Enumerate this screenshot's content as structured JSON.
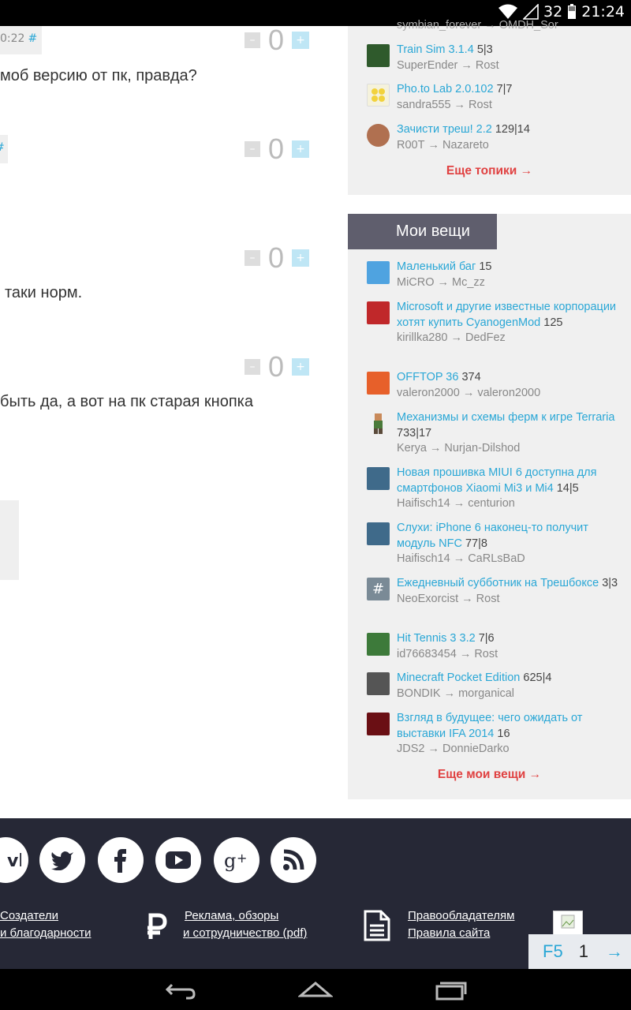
{
  "status_bar": {
    "battery": "32",
    "time": "21:24"
  },
  "comments": [
    {
      "time": "0:22",
      "hash": "#",
      "score": "0",
      "text": "моб версию от пк, правда?"
    },
    {
      "time": "",
      "hash": "#",
      "score": "0",
      "text": ""
    },
    {
      "time": "",
      "hash": "",
      "score": "0",
      "text": "таки норм."
    },
    {
      "time": "",
      "hash": "",
      "score": "0",
      "text": "быть да, а вот на пк старая кнопка"
    }
  ],
  "vote": {
    "minus": "–",
    "plus": "+"
  },
  "topics": {
    "cut_off": "symbian_forever → OMDH_Sor",
    "items": [
      {
        "title": "Train Sim 3.1.4",
        "count": "5|3",
        "author": "SuperEnder",
        "last": "Rost",
        "avatar_color": "#2f5a2c"
      },
      {
        "title": "Pho.to Lab 2.0.102",
        "count": "7|7",
        "author": "sandra555",
        "last": "Rost",
        "avatar_color": "#f3e9a0"
      },
      {
        "title": "Зачисти треш! 2.2",
        "count": "129|14",
        "author": "R00T",
        "last": "Nazareto",
        "avatar_color": "#b07050"
      }
    ],
    "more": "Еще топики →"
  },
  "my_things": {
    "title": "Мои вещи",
    "items": [
      {
        "title": "Маленький баг",
        "count": "15",
        "author": "MiCRO",
        "last": "Mc_zz",
        "avatar_color": "#4fa3e0"
      },
      {
        "title": "Microsoft и другие известные корпорации хотят купить CyanogenMod",
        "count": "125",
        "author": "kirillka280",
        "last": "DedFez",
        "avatar_color": "#c0282a"
      },
      {
        "title": "OFFTOP 36",
        "count": "374",
        "author": "valeron2000",
        "last": "valeron2000",
        "avatar_color": "#e7602a"
      },
      {
        "title": "Механизмы и схемы ферм к игре Terraria",
        "count": "733|17",
        "author": "Kerya",
        "last": "Nurjan-Dilshod",
        "avatar_color": "#6a5a3c"
      },
      {
        "title": "Новая прошивка MIUI 6 доступна для смартфонов Xiaomi Mi3 и Mi4",
        "count": "14|5",
        "author": "Haifisch14",
        "last": "centurion",
        "avatar_color": "#3f6a8a"
      },
      {
        "title": "Слухи: iPhone 6 наконец-то получит модуль NFC",
        "count": "77|8",
        "author": "Haifisch14",
        "last": "CaRLsBaD",
        "avatar_color": "#3f6a8a"
      },
      {
        "title": "Ежедневный субботник на Трешбоксе",
        "count": "3|3",
        "author": "NeoExorcist",
        "last": "Rost",
        "avatar_color": "#7a8a96"
      },
      {
        "title": "Hit Tennis 3 3.2",
        "count": "7|6",
        "author": "id76683454",
        "last": "Rost",
        "avatar_color": "#3d7a3a"
      },
      {
        "title": "Minecraft Pocket Edition",
        "count": "625|4",
        "author": "BONDIK",
        "last": "morganical",
        "avatar_color": "#555"
      },
      {
        "title": "Взгляд в будущее: чего ожидать от выставки IFA 2014",
        "count": "16",
        "author": "JDS2",
        "last": "DonnieDarko",
        "avatar_color": "#6a0f14"
      }
    ],
    "more": "Еще мои вещи →"
  },
  "footer": {
    "social": [
      "vk",
      "twitter",
      "facebook",
      "youtube",
      "google-plus",
      "rss"
    ],
    "links": {
      "creators": "Создатели",
      "thanks": "и благодарности",
      "ads": "Реклама, обзоры",
      "cooperation": "и сотрудничество (pdf)",
      "rights": "Правообладателям",
      "rules": "Правила сайта"
    }
  },
  "pager": {
    "refresh": "F5",
    "page": "1",
    "next": "→"
  },
  "arrow": "→"
}
